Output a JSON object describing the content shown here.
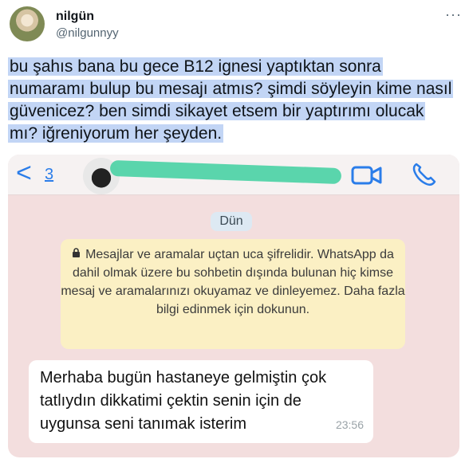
{
  "tweet": {
    "name": "nilgün",
    "handle": "@nilgunnyy",
    "more": "···",
    "text": "bu şahıs bana bu gece B12 ignesi yaptıktan sonra numaramı bulup bu mesajı atmıs? şimdi söyleyin kime nasıl güvenicez? ben simdi sikayet etsem bir yaptırımı olucak mı? iğreniyorum her şeyden."
  },
  "whatsapp": {
    "back": "<",
    "unread_count": "3",
    "date": "Dün",
    "encryption_notice": "Mesajlar ve aramalar uçtan uca şifrelidir. WhatsApp da dahil olmak üzere bu sohbetin dışında bulunan hiç kimse mesaj ve aramalarınızı okuyamaz ve dinleyemez. Daha fazla bilgi edinmek için dokunun.",
    "message": {
      "text": "Merhaba bugün hastaneye gelmiştin çok tatlıydın dikkatimi çektin  senin için de uygunsa seni tanımak isterim",
      "time": "23:56"
    },
    "icons": [
      "video-camera-icon",
      "phone-icon",
      "lock-icon"
    ],
    "accent": "#2b7de9"
  }
}
